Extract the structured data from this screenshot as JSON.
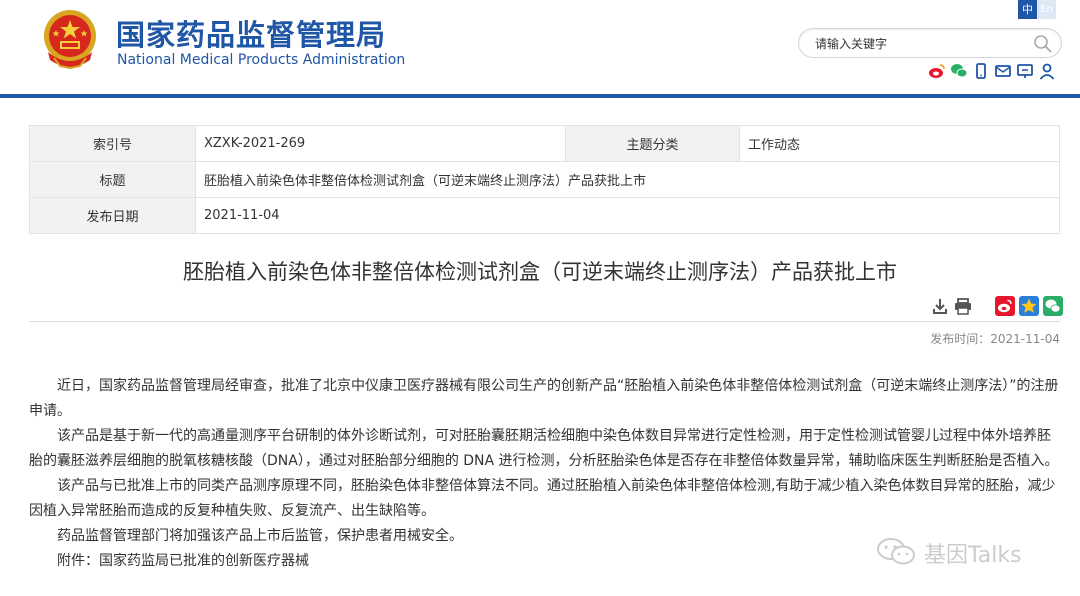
{
  "header": {
    "title_cn": "国家药品监督管理局",
    "title_en": "National Medical Products Administration",
    "lang_zh": "中",
    "lang_en": "En",
    "search_placeholder": "请输入关键字",
    "social_icons": [
      "weibo-icon",
      "wechat-icon",
      "mobile-icon",
      "mail-icon",
      "feedback-icon",
      "user-icon"
    ]
  },
  "info": {
    "index_label": "索引号",
    "index_value": "XZXK-2021-269",
    "category_label": "主题分类",
    "category_value": "工作动态",
    "title_label": "标题",
    "title_value": "胚胎植入前染色体非整倍体检测试剂盒（可逆末端终止测序法）产品获批上市",
    "date_label": "发布日期",
    "date_value": "2021-11-04"
  },
  "article": {
    "title": "胚胎植入前染色体非整倍体检测试剂盒（可逆末端终止测序法）产品获批上市",
    "publish_time": "发布时间：2021-11-04",
    "paragraphs": [
      "近日，国家药品监督管理局经审查，批准了北京中仪康卫医疗器械有限公司生产的创新产品“胚胎植入前染色体非整倍体检测试剂盒（可逆末端终止测序法）”的注册申请。",
      "该产品是基于新一代的高通量测序平台研制的体外诊断试剂，可对胚胎囊胚期活检细胞中染色体数目异常进行定性检测，用于定性检测试管婴儿过程中体外培养胚胎的囊胚滋养层细胞的脱氧核糖核酸（DNA），通过对胚胎部分细胞的 DNA 进行检测，分析胚胎染色体是否存在非整倍体数量异常，辅助临床医生判断胚胎是否植入。",
      "该产品与已批准上市的同类产品测序原理不同，胚胎染色体非整倍体算法不同。通过胚胎植入前染色体非整倍体检测,有助于减少植入染色体数目异常的胚胎，减少因植入异常胚胎而造成的反复种植失败、反复流产、出生缺陷等。",
      "药品监督管理部门将加强该产品上市后监管，保护患者用械安全。",
      "附件：国家药监局已批准的创新医疗器械"
    ]
  },
  "watermark": {
    "text": "基因Talks"
  },
  "colors": {
    "brand_blue": "#1f56a5",
    "label_bg": "#f2f2f2"
  }
}
